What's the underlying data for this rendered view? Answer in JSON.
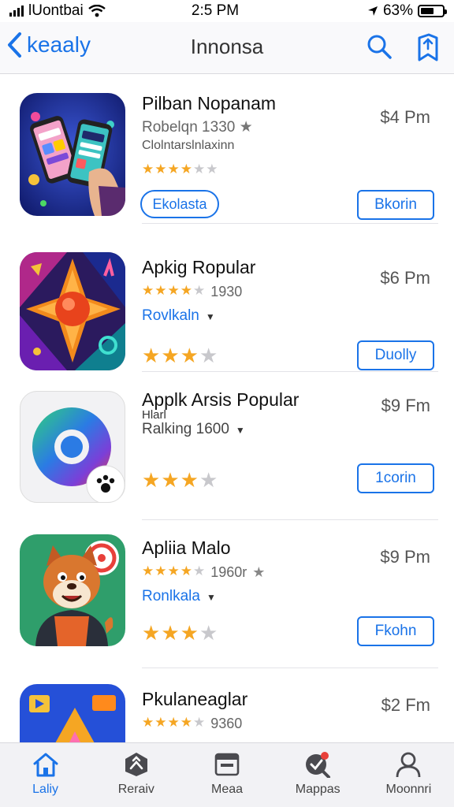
{
  "status_bar": {
    "carrier": "lUontbai",
    "time": "2:5 PM",
    "battery": "63%",
    "battery_level": 0.63
  },
  "nav": {
    "back_label": "keaaly",
    "title": "Innonsa"
  },
  "apps": [
    {
      "name": "Pilban Nopanam",
      "price": "$4 Pm",
      "sub1": "Robelqn 1330",
      "sub2": "Clolntarslnlaxinn",
      "stars": 3.5,
      "button": "Bkorin",
      "pill": "Ekolasta"
    },
    {
      "name": "Apkig Ropular",
      "price": "$6 Pm",
      "sub1": "1930",
      "stars_small": 4,
      "link": "Rovlkaln",
      "stars": 3,
      "button": "Duolly"
    },
    {
      "name": "Applk Arsis Popular",
      "price": "$9 Fm",
      "sub1": "Hlarl",
      "link_plain": "Ralking 1600",
      "stars": 3,
      "button": "1corin"
    },
    {
      "name": "Apliia Malo",
      "price": "$9 Pm",
      "sub1": "1960r",
      "stars_small": 4,
      "link": "Ronlkala",
      "stars": 3,
      "button": "Fkohn"
    },
    {
      "name": "Pkulaneaglar",
      "price": "$2 Fm",
      "sub1": "9360",
      "stars_small": 4
    }
  ],
  "tabs": [
    {
      "label": "Laliy",
      "icon": "home-icon"
    },
    {
      "label": "Reraiv",
      "icon": "apps-icon"
    },
    {
      "label": "Meaa",
      "icon": "window-icon"
    },
    {
      "label": "Mappas",
      "icon": "search-badge-icon"
    },
    {
      "label": "Moonnri",
      "icon": "person-icon"
    }
  ]
}
